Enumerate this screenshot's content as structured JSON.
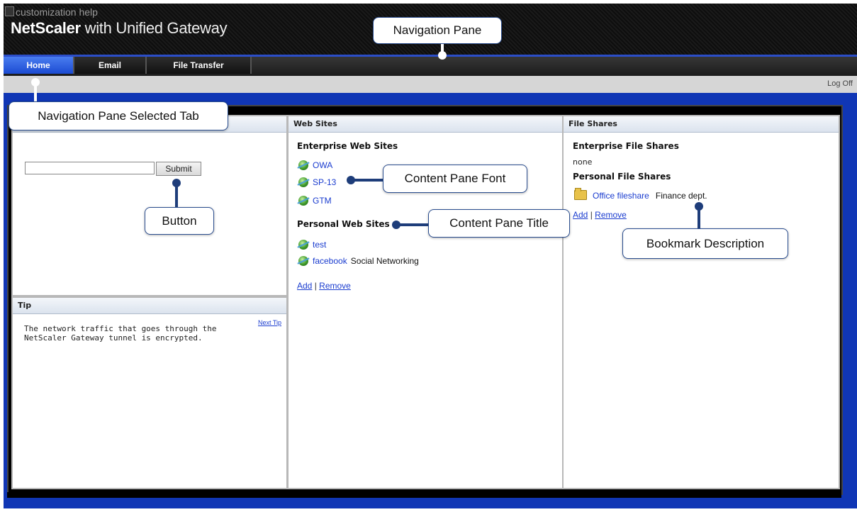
{
  "header": {
    "broken_image_alt": "customization help",
    "brand_bold": "NetScaler",
    "brand_rest": " with Unified Gateway"
  },
  "tabs": [
    {
      "label": "Home",
      "active": true
    },
    {
      "label": "Email",
      "active": false
    },
    {
      "label": "File Transfer",
      "active": false
    }
  ],
  "logoff_label": "Log Off",
  "left_panel": {
    "search_value": "",
    "submit_label": "Submit"
  },
  "tip_panel": {
    "title": "Tip",
    "next_tip_label": "Next Tip",
    "text": "The network traffic that goes through the NetScaler Gateway tunnel is encrypted."
  },
  "web_sites": {
    "title": "Web Sites",
    "enterprise_heading": "Enterprise Web Sites",
    "enterprise_items": [
      {
        "label": "OWA",
        "description": ""
      },
      {
        "label": "SP-13",
        "description": ""
      },
      {
        "label": "GTM",
        "description": ""
      }
    ],
    "personal_heading": "Personal Web Sites",
    "personal_items": [
      {
        "label": "test",
        "description": ""
      },
      {
        "label": "facebook",
        "description": "Social Networking"
      }
    ],
    "add_label": "Add",
    "separator": "|",
    "remove_label": "Remove"
  },
  "file_shares": {
    "title": "File Shares",
    "enterprise_heading": "Enterprise File Shares",
    "enterprise_empty": "none",
    "personal_heading": "Personal File Shares",
    "personal_items": [
      {
        "label": "Office fileshare",
        "description": "Finance dept."
      }
    ],
    "add_label": "Add",
    "separator": "|",
    "remove_label": "Remove"
  },
  "callouts": {
    "navigation_pane": "Navigation Pane",
    "selected_tab": "Navigation Pane Selected Tab",
    "button": "Button",
    "content_font": "Content Pane Font",
    "content_title": "Content Pane Title",
    "bookmark_description": "Bookmark Description"
  },
  "colors": {
    "accent_blue": "#1036b5",
    "callout_line": "#1e3d7a",
    "link": "#1a3ccf"
  },
  "icons": {
    "web_link": "globe-icon",
    "file_share": "folder-icon"
  }
}
